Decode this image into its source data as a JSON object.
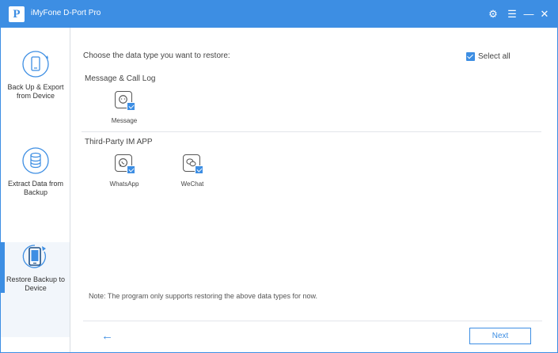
{
  "window": {
    "title": "iMyFone D-Port Pro",
    "logo_letter": "P",
    "controls": {
      "settings_glyph": "⚙",
      "menu_glyph": "☰",
      "minimize_glyph": "—",
      "close_glyph": "✕"
    }
  },
  "sidebar": {
    "items": [
      {
        "label": "Back Up & Export from Device",
        "icon": "phone-sync-icon",
        "active": false
      },
      {
        "label": "Extract Data from Backup",
        "icon": "database-icon",
        "active": false
      },
      {
        "label": "Restore Backup to Device",
        "icon": "phone-restore-icon",
        "active": true
      }
    ]
  },
  "main": {
    "prompt": "Choose the data type you want to restore:",
    "select_all": {
      "label": "Select all",
      "checked": true
    },
    "sections": [
      {
        "title": "Message & Call Log",
        "items": [
          {
            "label": "Message",
            "icon": "message-icon",
            "checked": true
          }
        ]
      },
      {
        "title": "Third-Party IM APP",
        "items": [
          {
            "label": "WhatsApp",
            "icon": "whatsapp-icon",
            "checked": true
          },
          {
            "label": "WeChat",
            "icon": "wechat-icon",
            "checked": true
          }
        ]
      }
    ],
    "note": "Note: The program only supports restoring the above data types for now.",
    "back_glyph": "←",
    "next_label": "Next"
  },
  "colors": {
    "accent": "#3d8ee3",
    "text": "#444444",
    "divider": "#e2e5ea"
  }
}
